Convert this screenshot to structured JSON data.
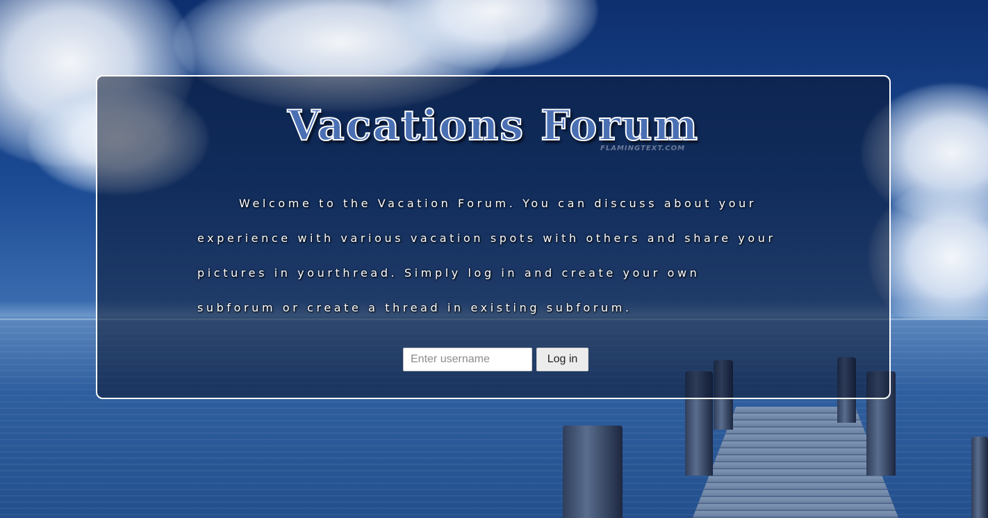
{
  "header": {
    "title": "Vacations Forum",
    "title_watermark": "FLAMINGTEXT.COM"
  },
  "intro": {
    "text": "Welcome to the Vacation Forum. You can discuss about your experience with various vacation spots with others and share your pictures in yourthread. Simply log in and create your own subforum or create a thread in existing subforum."
  },
  "login": {
    "username_placeholder": "Enter username",
    "username_value": "",
    "button_label": "Log in"
  },
  "colors": {
    "title_fill": "#4a6fb3",
    "title_outline": "#ffffff",
    "panel_border": "#ffffff"
  }
}
